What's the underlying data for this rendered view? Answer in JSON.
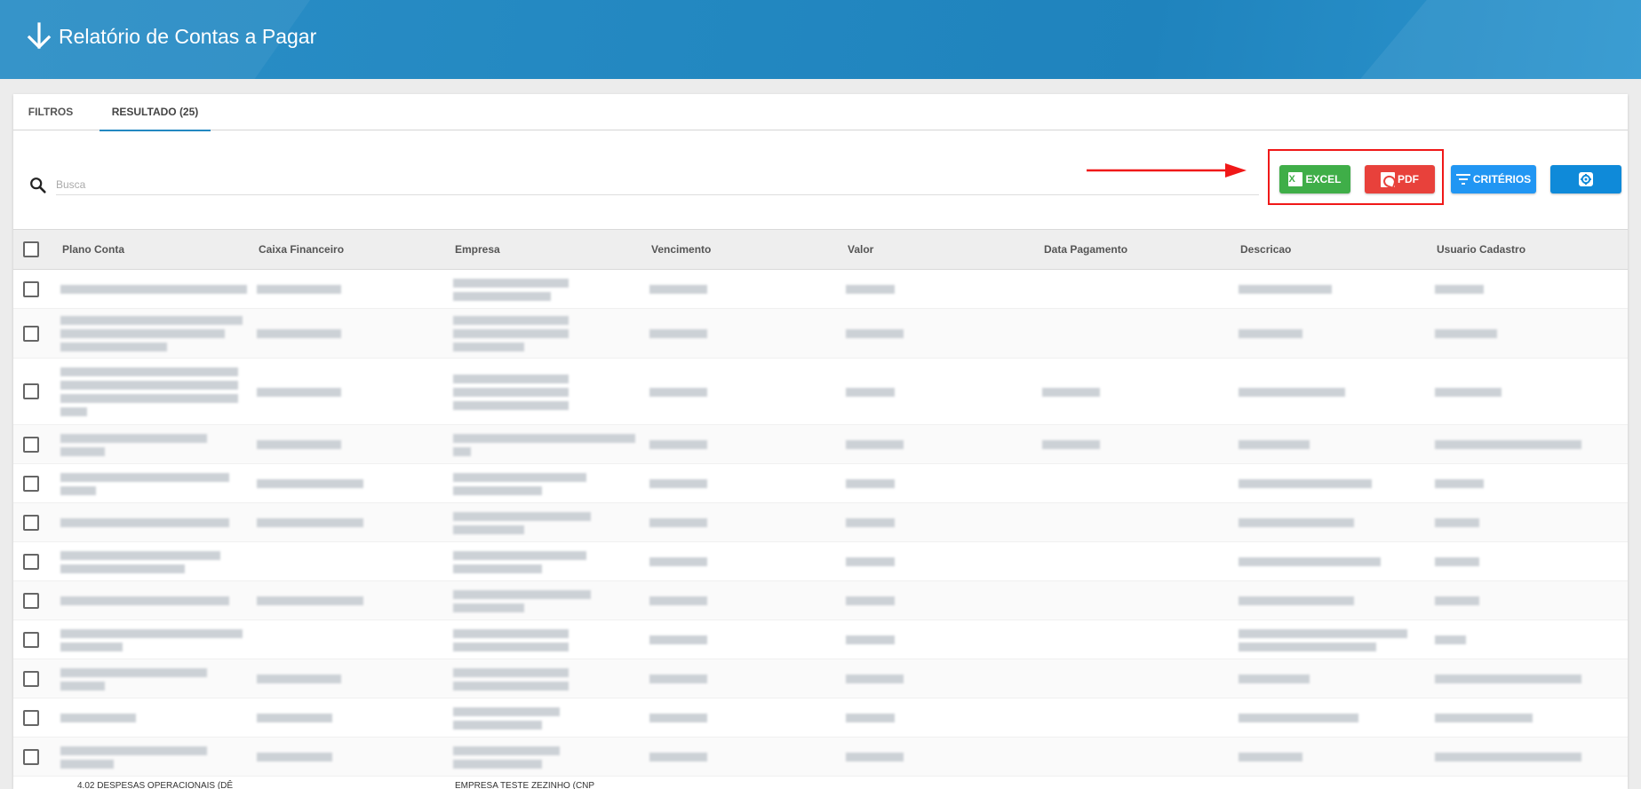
{
  "header": {
    "title": "Relatório de Contas a Pagar",
    "icon": "arrow-down-icon"
  },
  "tabs": [
    {
      "label": "FILTROS",
      "active": false
    },
    {
      "label": "RESULTADO (25)",
      "active": true
    }
  ],
  "search": {
    "placeholder": "Busca",
    "value": ""
  },
  "toolbar": {
    "excel_label": "EXCEL",
    "pdf_label": "PDF",
    "criteria_label": "CRITÉRIOS",
    "settings_icon": "gear-icon"
  },
  "colors": {
    "header": "#2388c1",
    "excel": "#3fae48",
    "pdf": "#e8413b",
    "criteria": "#2196f3",
    "settings": "#0f8ad9",
    "highlight": "#f01818"
  },
  "table": {
    "columns": [
      "Plano Conta",
      "Caixa Financeiro",
      "Empresa",
      "Vencimento",
      "Valor",
      "Data Pagamento",
      "Descricao",
      "Usuario Cadastro"
    ],
    "partial_row": {
      "plano_conta": "4.02 DESPESAS OPERACIONAIS (DÊ",
      "empresa": "EMPRESA TESTE ZEZINHO (CNP"
    }
  }
}
